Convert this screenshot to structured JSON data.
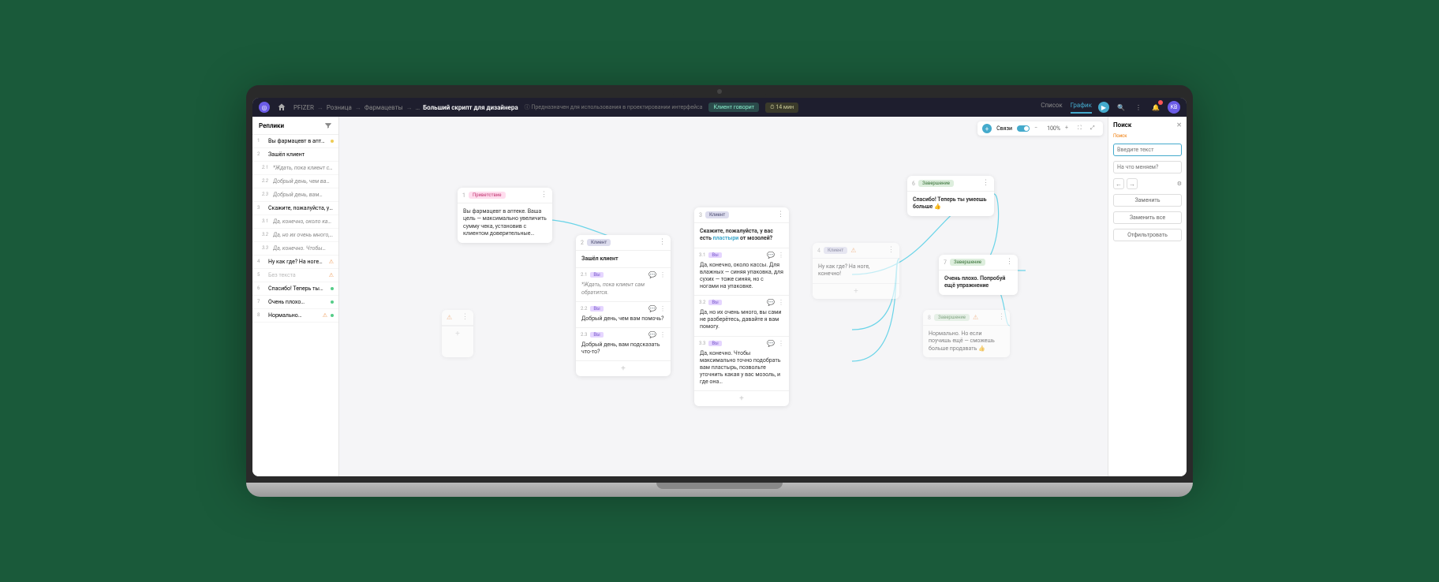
{
  "topbar": {
    "breadcrumb": [
      "PFIZER",
      "Розница",
      "Фармацевты",
      "…"
    ],
    "current": "Больший скрипт для дизайнера",
    "info": "Предназначен для использования в проектировании интерфейса",
    "client_pill": "Клиент говорит",
    "time_pill": "14 мин",
    "tabs": {
      "list": "Список",
      "graph": "График"
    },
    "avatar": "KB"
  },
  "sidebar": {
    "title": "Реплики",
    "items": [
      {
        "n": "1",
        "t": "Вы фармацевт в аптеке…",
        "dot": "yellow"
      },
      {
        "n": "2",
        "t": "Зашёл клиент"
      },
      {
        "n": "2.1",
        "t": "*Ждать, пока клиент сам…",
        "sub": true
      },
      {
        "n": "2.2",
        "t": "Добрый день, чем вам…",
        "sub": true
      },
      {
        "n": "2.3",
        "t": "Добрый день, вам…",
        "sub": true
      },
      {
        "n": "3",
        "t": "Скажите, пожалуйста, у вас…"
      },
      {
        "n": "3.1",
        "t": "Да, конечно, около касс…",
        "sub": true
      },
      {
        "n": "3.2",
        "t": "Да, но их очень много, в…",
        "sub": true
      },
      {
        "n": "3.3",
        "t": "Да, конечно. Чтобы…",
        "sub": true
      },
      {
        "n": "4",
        "t": "Ну как где? На ноге…",
        "warn": true
      },
      {
        "n": "5",
        "t": "Без текста",
        "grey": true,
        "warn": true
      },
      {
        "n": "6",
        "t": "Спасибо! Теперь ты…",
        "dot": "green"
      },
      {
        "n": "7",
        "t": "Очень плохо…",
        "dot": "green"
      },
      {
        "n": "8",
        "t": "Нормально…",
        "dot": "green",
        "warn": true
      }
    ]
  },
  "canvas": {
    "toolbar": {
      "links": "Связи",
      "zoom": "100%"
    },
    "nodes": {
      "n1": {
        "num": "1",
        "tag": "Приветствие",
        "body": "Вы фармацевт в аптеке. Ваша цель — максимально увеличить сумму чека, установив с клиентом доверительные…"
      },
      "n2": {
        "num": "2",
        "tag": "Клиент",
        "body": "Зашёл клиент",
        "replies": [
          {
            "n": "2.1",
            "badge": "Вы",
            "t": "*Ждать, пока клиент сам обратится.",
            "italic": true
          },
          {
            "n": "2.2",
            "badge": "Вы",
            "t": "Добрый день, чем вам помочь?"
          },
          {
            "n": "2.3",
            "badge": "Вы",
            "t": "Добрый день, вам подсказать что-то?"
          }
        ]
      },
      "n3": {
        "num": "3",
        "tag": "Клиент",
        "body": "Скажите, пожалуйста, у вас есть пластыри от мозолей?",
        "hl": "пластыри",
        "replies": [
          {
            "n": "3.1",
            "badge": "Вы",
            "t": "Да, конечно, около кассы. Для влажных — синяя упаковка, для сухих — тоже синяя, но с ногами на упаковке."
          },
          {
            "n": "3.2",
            "badge": "Вы",
            "t": "Да, но их очень много, вы сами не разберётесь, давайте я вам помогу."
          },
          {
            "n": "3.3",
            "badge": "Вы",
            "t": "Да, конечно. Чтобы максимально точно подобрать вам пластырь, позвольте уточнить какая у вас мозоль, и где она…"
          }
        ]
      },
      "n4": {
        "num": "4",
        "tag": "Клиент",
        "body": "Ну как где? На ноге, конечно!",
        "warn": true
      },
      "n6": {
        "num": "6",
        "tag": "Завершение",
        "body": "Спасибо! Теперь ты умеешь больше 👍"
      },
      "n7": {
        "num": "7",
        "tag": "Завершение",
        "body": "Очень плохо. Попробуй ещё упражнение"
      },
      "n8": {
        "num": "8",
        "tag": "Завершение",
        "body": "Нормально. Но если поучишь ещё — сможешь больше продавать 👍",
        "warn": true
      }
    }
  },
  "search": {
    "title": "Поиск",
    "label": "Поиск",
    "placeholder": "Введите текст",
    "replace_ph": "На что меняем?",
    "btn_replace": "Заменить",
    "btn_replace_all": "Заменить все",
    "btn_filter": "Отфильтровать"
  }
}
